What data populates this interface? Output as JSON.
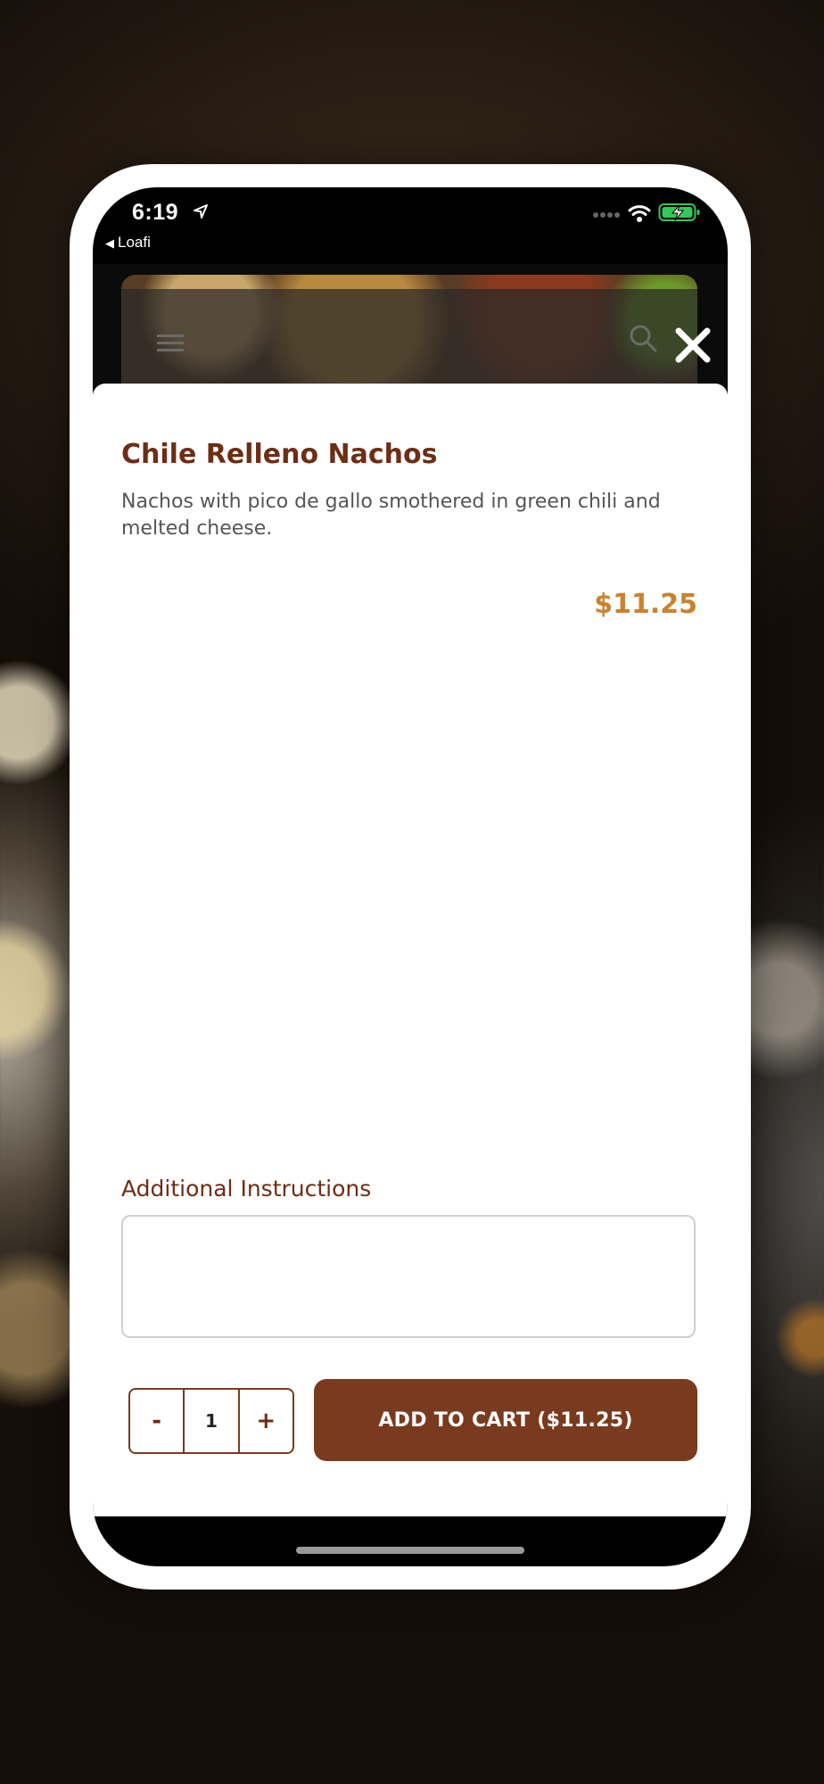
{
  "status_bar": {
    "time": "6:19",
    "back_app": "Loafi"
  },
  "item": {
    "title": "Chile Relleno Nachos",
    "description": "Nachos with pico de gallo smothered in green chili and melted cheese.",
    "price": "$11.25"
  },
  "instructions": {
    "label": "Additional Instructions",
    "value": "",
    "placeholder": ""
  },
  "quantity": {
    "minus": "-",
    "value": "1",
    "plus": "+"
  },
  "cart_button": {
    "label": "ADD TO CART ($11.25)"
  },
  "colors": {
    "brand_brown": "#7a3a1e",
    "title_brown": "#6e2d14",
    "price_orange": "#c9822f",
    "battery_green": "#34c759"
  },
  "icons": [
    "location-arrow-icon",
    "signal-icon",
    "wifi-icon",
    "battery-charging-icon",
    "menu-icon",
    "search-icon",
    "close-icon"
  ]
}
